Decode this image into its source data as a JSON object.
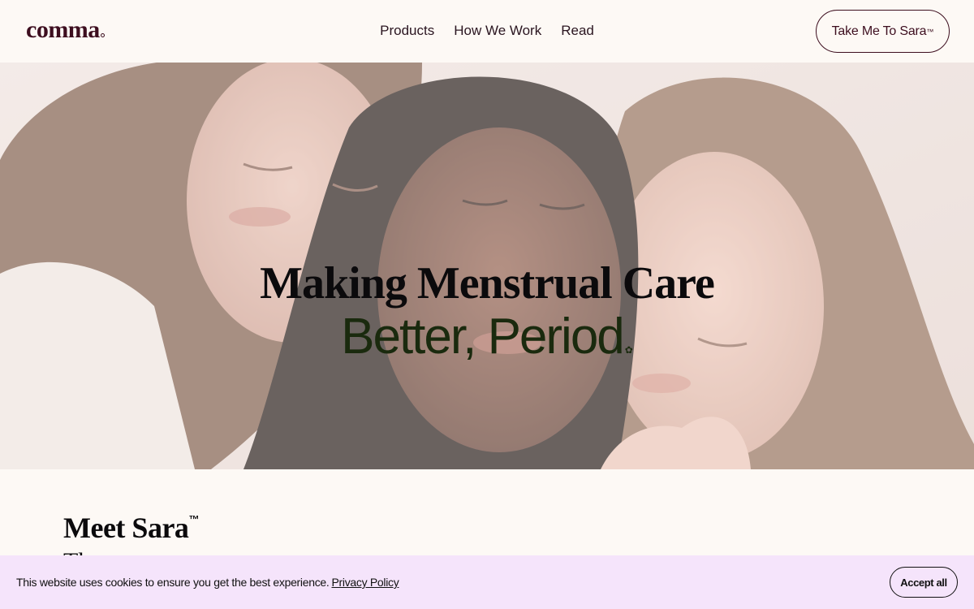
{
  "header": {
    "logo": "comma",
    "nav": {
      "products": "Products",
      "how_we_work": "How We Work",
      "read": "Read"
    },
    "cta_label": "Take Me To Sara",
    "cta_tm": "™"
  },
  "hero": {
    "title": "Making Menstrual Care",
    "subtitle": "Better, Period",
    "subtitle_mark": "✿",
    "image_subject": "hero-photo"
  },
  "intro": {
    "heading": "Meet Sara",
    "heading_tm": "™",
    "next_line": "The"
  },
  "cookie_banner": {
    "message": "This website uses cookies to ensure you get the best experience.",
    "link_label": "Privacy Policy",
    "accept_label": "Accept all"
  },
  "colors": {
    "brand": "#3d0e1f",
    "page_bg": "#fdf9f5",
    "cookie_bg": "#f5e4fb",
    "subtitle_green": "#1a2a0e"
  }
}
